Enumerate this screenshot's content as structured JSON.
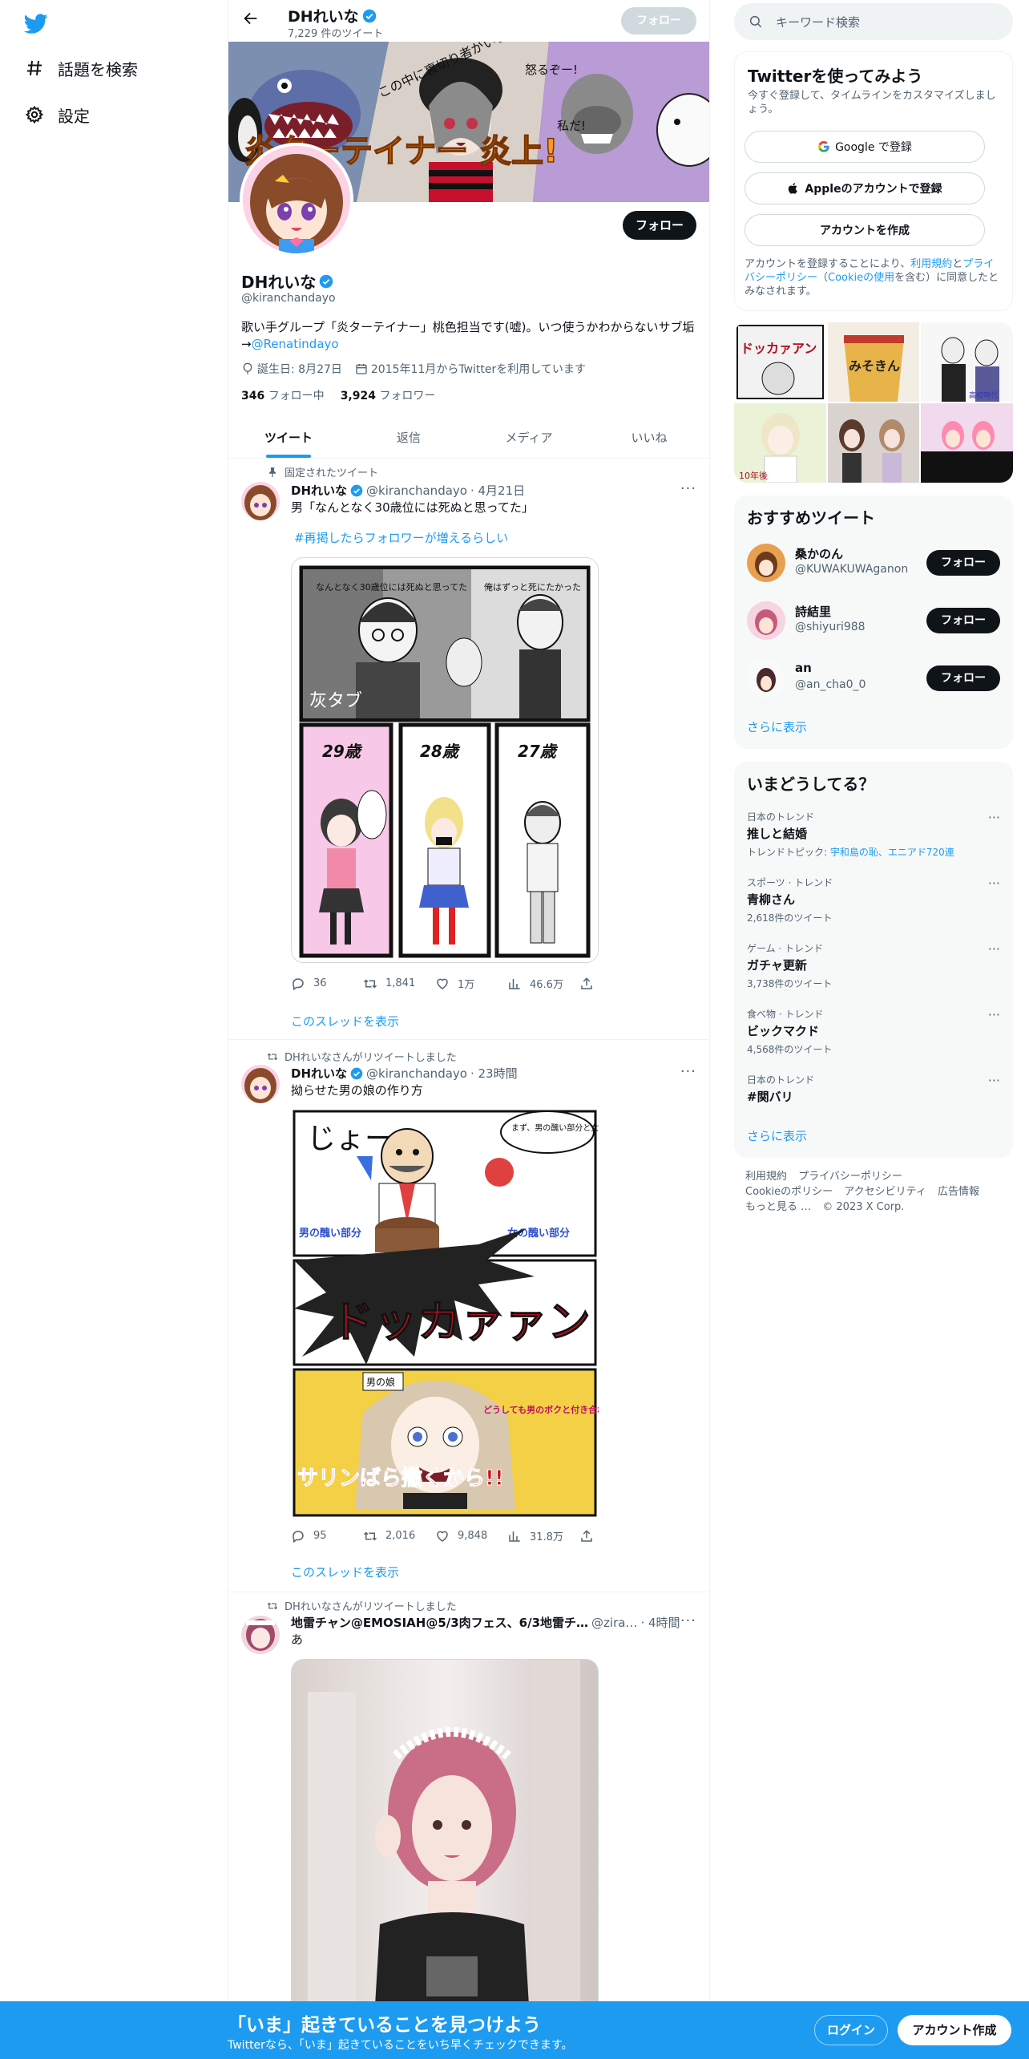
{
  "nav": {
    "logo": "twitter-bird-icon",
    "items": [
      {
        "label": "話題を検索",
        "icon": "hashtag-icon"
      },
      {
        "label": "設定",
        "icon": "gear-icon"
      }
    ]
  },
  "header": {
    "name": "DHれいな",
    "tweet_count": "7,229 件のツイート",
    "follow_label": "フォロー"
  },
  "profile": {
    "name": "DHれいな",
    "handle": "@kiranchandayo",
    "follow_label": "フォロー",
    "bio_text": "歌い手グループ「炎ターテイナー」桃色担当です(嘘)。いつ使うかわからないサブ垢→",
    "bio_link": "@Renatindayo",
    "birthday": "誕生日: 8月27日",
    "joined": "2015年11月からTwitterを利用しています",
    "following_count": "346",
    "following_label": "フォロー中",
    "followers_count": "3,924",
    "followers_label": "フォロワー"
  },
  "tabs": [
    "ツイート",
    "返信",
    "メディア",
    "いいね"
  ],
  "tweets": [
    {
      "context": "固定されたツイート",
      "name": "DHれいな",
      "handle": "@kiranchandayo",
      "time": "· 4月21日",
      "text": "男「なんとなく30歳位には死ぬと思ってた」",
      "hashtag": "#再掲したらフォロワーが増えるらしい",
      "replies": "36",
      "retweets": "1,841",
      "likes": "1万",
      "views": "46.6万",
      "thread_link": "このスレッドを表示",
      "media_text": {
        "label_hai": "灰タブ",
        "age1": "29歳",
        "age2": "28歳",
        "age3": "27歳",
        "caption1": "なんとなく30歳位には死ぬと思ってた",
        "caption2": "俺はずっと死にたかった"
      }
    },
    {
      "context": "DHれいなさんがリツイートしました",
      "name": "DHれいな",
      "handle": "@kiranchandayo",
      "time": "· 23時間",
      "text": "拗らせた男の娘の作り方",
      "replies": "95",
      "retweets": "2,016",
      "likes": "9,848",
      "views": "31.8万",
      "thread_link": "このスレッドを表示",
      "media_text": {
        "joo": "じょー",
        "bubble": "まず、男の醜い部分と女の醜い部分を混ぜます。",
        "left_label": "男の醜い部分",
        "right_label": "女の醜い部分",
        "boom": "ドッカァァン",
        "tag": "男の娘",
        "big": "サリンばら撒くから!!",
        "speech": "どうしても男のボクと付き合わないって言うのならば……"
      }
    },
    {
      "context": "DHれいなさんがリツイートしました",
      "name": "地雷チャン@EMOSIAH@5/3肉フェス、6/3地雷チ…",
      "handle": "@zira…",
      "time": "· 4時間",
      "text": "あ"
    }
  ],
  "banner_text": {
    "text1": "この中に裏切り者がいます!!",
    "text2": "怒るぞー!",
    "text3": "私だ!",
    "title": "炎ターテイナー 炎上!"
  },
  "right": {
    "search_placeholder": "キーワード検索",
    "signup": {
      "title": "Twitterを使ってみよう",
      "subtitle": "今すぐ登録して、タイムラインをカスタマイズしましょう。",
      "google": "Google で登録",
      "apple": "Appleのアカウントで登録",
      "create": "アカウントを作成",
      "terms_a": "アカウントを登録することにより、",
      "terms_link1": "利用規約",
      "terms_b": "と",
      "terms_link2": "プライバシーポリシー",
      "terms_c": "（",
      "terms_link3": "Cookieの使用",
      "terms_d": "を含む）に同意したとみなされます。"
    },
    "photo_grid_text": {
      "p1": "ドッカァアン",
      "p2": "みそきん",
      "p3": "高校時代",
      "p5": "10年後"
    },
    "suggest": {
      "title": "おすすめツイート",
      "follow_label": "フォロー",
      "users": [
        {
          "name": "桑かのん",
          "handle": "@KUWAKUWAganon"
        },
        {
          "name": "詩結里",
          "handle": "@shiyuri988"
        },
        {
          "name": "an",
          "handle": "@an_cha0_0"
        }
      ],
      "more": "さらに表示"
    },
    "trends": {
      "title": "いまどうしてる？",
      "items": [
        {
          "category": "日本のトレンド",
          "title": "推しと結婚",
          "sub_prefix": "トレンドトピック: ",
          "sub_link": "宇和島の恥、エニアド720連"
        },
        {
          "category": "スポーツ · トレンド",
          "title": "青柳さん",
          "sub": "2,618件のツイート"
        },
        {
          "category": "ゲーム · トレンド",
          "title": "ガチャ更新",
          "sub": "3,738件のツイート"
        },
        {
          "category": "食べ物 · トレンド",
          "title": "ビックマクド",
          "sub": "4,568件のツイート"
        },
        {
          "category": "日本のトレンド",
          "title": "#関バリ"
        }
      ],
      "more": "さらに表示"
    },
    "footer": {
      "links": [
        "利用規約",
        "プライバシーポリシー",
        "Cookieのポリシー",
        "アクセシビリティ",
        "広告情報",
        "もっと見る …",
        "© 2023 X Corp."
      ]
    }
  },
  "bottombar": {
    "title": "「いま」起きていることを見つけよう",
    "subtitle": "Twitterなら、「いま」起きていることをいち早くチェックできます。",
    "login": "ログイン",
    "signup": "アカウント作成"
  },
  "colors": {
    "accent": "#1d9bf0",
    "text": "#0f1419",
    "secondary": "#536471",
    "border": "#eff3f4"
  }
}
